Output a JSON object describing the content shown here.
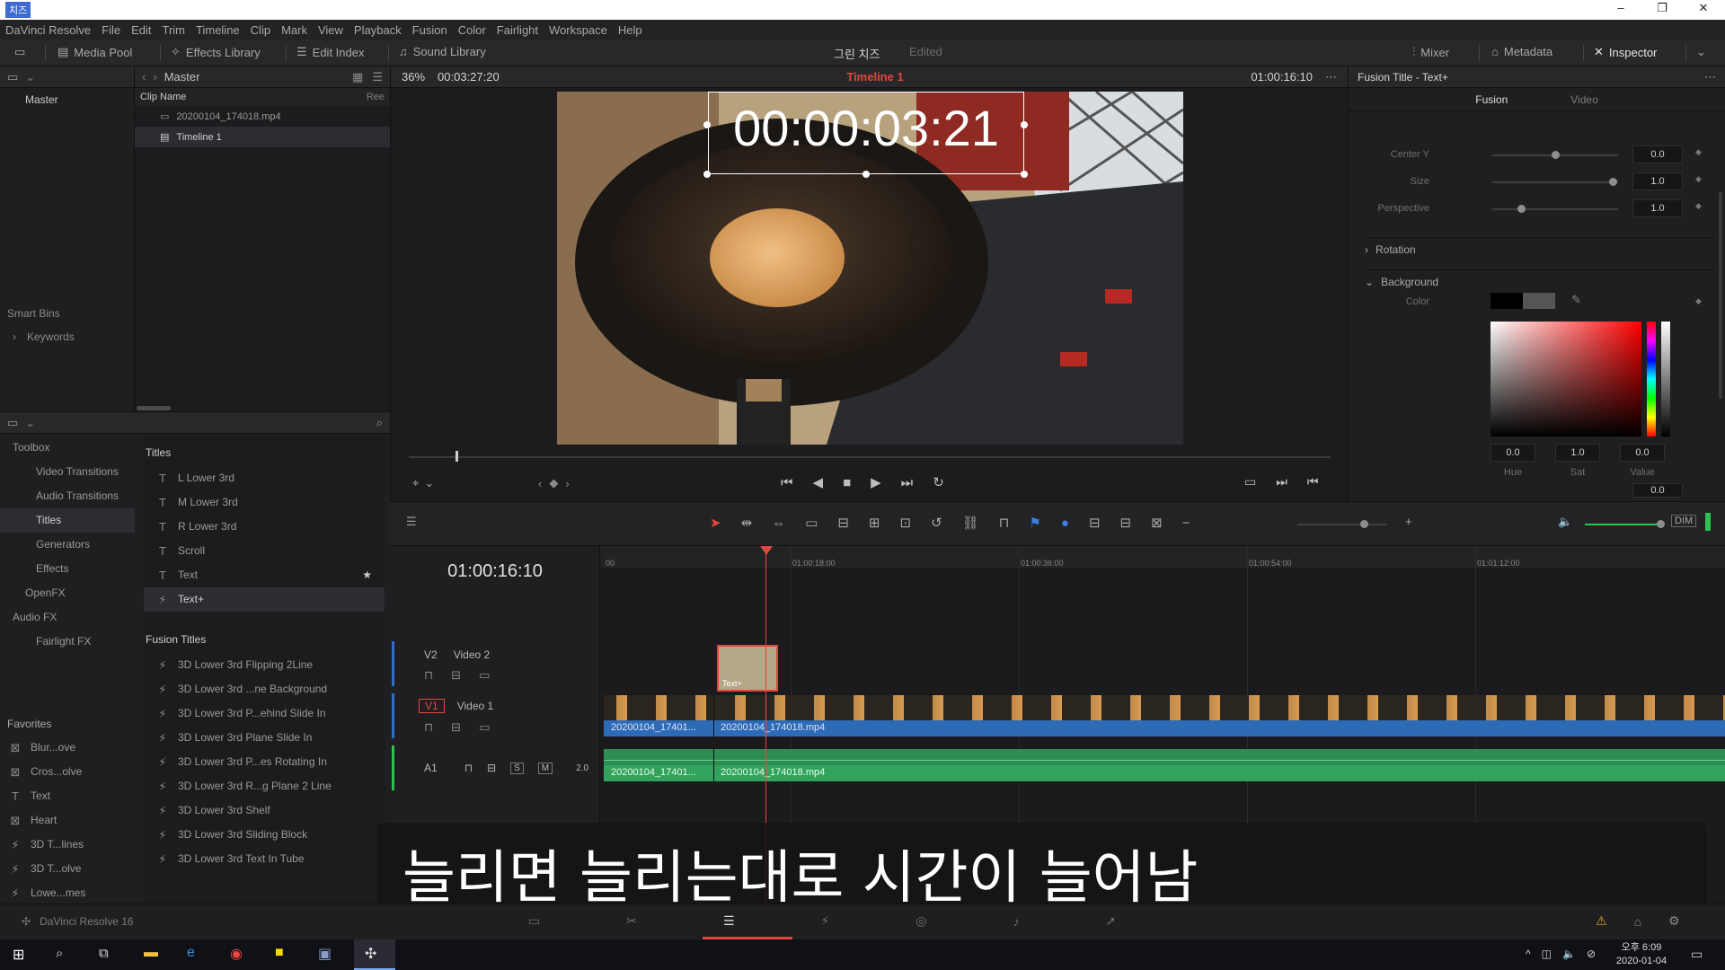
{
  "titlebar": {
    "app": "DaVinci Resolve",
    "icon_label": "치즈"
  },
  "menu": [
    "DaVinci Resolve",
    "File",
    "Edit",
    "Trim",
    "Timeline",
    "Clip",
    "Mark",
    "View",
    "Playback",
    "Fusion",
    "Color",
    "Fairlight",
    "Workspace",
    "Help"
  ],
  "toolbar": {
    "media_pool": "Media Pool",
    "effects_library": "Effects Library",
    "edit_index": "Edit Index",
    "sound_library": "Sound Library",
    "project": "그린 치즈",
    "project_status": "Edited",
    "mixer": "Mixer",
    "metadata": "Metadata",
    "inspector": "Inspector"
  },
  "media": {
    "path": "Master",
    "bin": "Master",
    "col_clip": "Clip Name",
    "col_reel": "Ree",
    "clips": [
      "20200104_174018.mp4",
      "Timeline 1"
    ],
    "smart_bins": "Smart Bins",
    "keywords": "Keywords"
  },
  "viewer": {
    "zoom": "36%",
    "duration": "00:03:27:20",
    "timeline_name": "Timeline 1",
    "timecode": "01:00:16:10",
    "overlay_timecode": "00:00:03:21"
  },
  "effects": {
    "tree": [
      "Toolbox",
      "Video Transitions",
      "Audio Transitions",
      "Titles",
      "Generators",
      "Effects",
      "OpenFX",
      "Audio FX",
      "Fairlight FX"
    ],
    "titles_header": "Titles",
    "titles": [
      "L Lower 3rd",
      "M Lower 3rd",
      "R Lower 3rd",
      "Scroll",
      "Text",
      "Text+"
    ],
    "fusion_header": "Fusion Titles",
    "fusion_titles": [
      "3D Lower 3rd Flipping 2Line",
      "3D Lower 3rd ...ne Background",
      "3D Lower 3rd P...ehind Slide In",
      "3D Lower 3rd Plane Slide In",
      "3D Lower 3rd P...es Rotating In",
      "3D Lower 3rd R...g Plane 2 Line",
      "3D Lower 3rd Shelf",
      "3D Lower 3rd Sliding Block",
      "3D Lower 3rd Text In Tube"
    ]
  },
  "favorites": {
    "header": "Favorites",
    "items": [
      "Blur...ove",
      "Cros...olve",
      "Text",
      "Heart",
      "3D T...lines",
      "3D T...olve",
      "Lowe...mes"
    ]
  },
  "inspector": {
    "title": "Fusion Title - Text+",
    "tab_fusion": "Fusion",
    "tab_video": "Video",
    "center_y": "Center Y",
    "center_y_val": "0.0",
    "size": "Size",
    "size_val": "1.0",
    "perspective": "Perspective",
    "perspective_val": "1.0",
    "rotation": "Rotation",
    "background": "Background",
    "color": "Color",
    "hue": "Hue",
    "hue_val": "0.0",
    "sat": "Sat",
    "sat_val": "1.0",
    "value": "Value",
    "value_val": "0.0",
    "extra_val": "0.0"
  },
  "timeline": {
    "timecode": "01:00:16:10",
    "ruler": [
      "00",
      "01:00:18:00",
      "01:00:36:00",
      "01:00:54:00",
      "01:01:12:00"
    ],
    "v2": "V2",
    "v2_name": "Video 2",
    "v1": "V1",
    "v1_name": "Video 1",
    "a1": "A1",
    "a1_level": "2.0",
    "title_clip": "Text+",
    "clip_a": "20200104_17401...",
    "clip_b": "20200104_174018.mp4"
  },
  "subtitle": "늘리면 늘리는대로 시간이 늘어남",
  "status": {
    "app": "DaVinci Resolve 16"
  },
  "taskbar": {
    "time": "오후 6:09",
    "date": "2020-01-04"
  }
}
